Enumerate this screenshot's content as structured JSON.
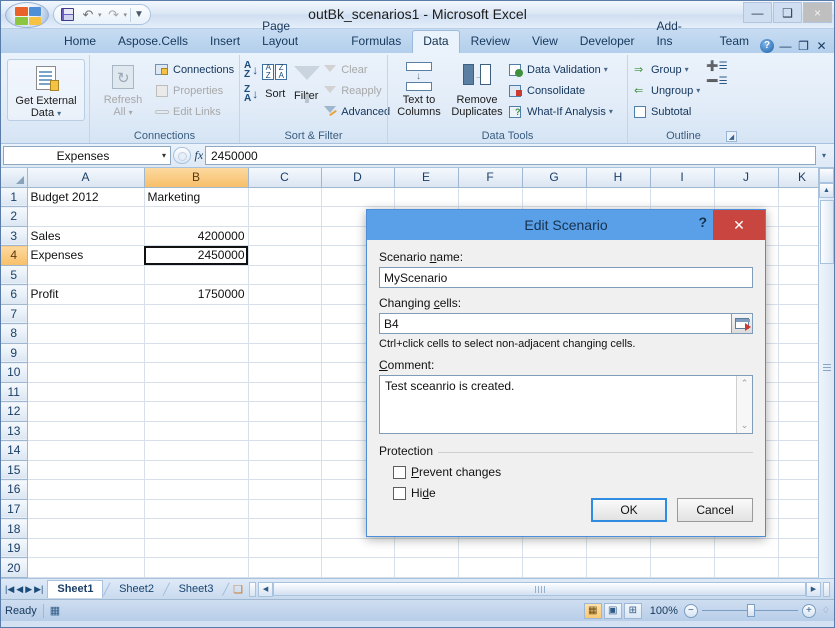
{
  "window": {
    "title": "outBk_scenarios1 - Microsoft Excel",
    "minimize": "—",
    "maximize": "❐",
    "close": "×"
  },
  "quick_access": {
    "office_button": "office-orb",
    "save": "save-icon",
    "undo": "↰",
    "undo_caret": "▾",
    "redo": "↱",
    "redo_caret": "▾",
    "customize": "▾"
  },
  "ribbon": {
    "tabs": [
      {
        "label": "Home",
        "active": false
      },
      {
        "label": "Aspose.Cells",
        "active": false
      },
      {
        "label": "Insert",
        "active": false
      },
      {
        "label": "Page Layout",
        "active": false
      },
      {
        "label": "Formulas",
        "active": false
      },
      {
        "label": "Data",
        "active": true
      },
      {
        "label": "Review",
        "active": false
      },
      {
        "label": "View",
        "active": false
      },
      {
        "label": "Developer",
        "active": false
      },
      {
        "label": "Add-Ins",
        "active": false
      },
      {
        "label": "Team",
        "active": false
      }
    ],
    "help_label": "?",
    "win_minimize": "—",
    "win_restore": "❐",
    "win_close": "✕",
    "groups": {
      "external": {
        "label": "",
        "button_line1": "Get External",
        "button_line2": "Data",
        "caret": "▾"
      },
      "connections": {
        "label": "Connections",
        "refresh_line1": "Refresh",
        "refresh_line2": "All",
        "refresh_caret": "▾",
        "items": [
          {
            "label": "Connections",
            "disabled": false
          },
          {
            "label": "Properties",
            "disabled": true
          },
          {
            "label": "Edit Links",
            "disabled": true
          }
        ]
      },
      "sort_filter": {
        "label": "Sort & Filter",
        "sort_az": "A\nZ",
        "sort_za": "Z\nA",
        "sort_label": "Sort",
        "filter_label": "Filter",
        "items": [
          {
            "label": "Clear",
            "disabled": true
          },
          {
            "label": "Reapply",
            "disabled": true
          },
          {
            "label": "Advanced",
            "disabled": false
          }
        ]
      },
      "data_tools": {
        "label": "Data Tools",
        "text_to_columns_line1": "Text to",
        "text_to_columns_line2": "Columns",
        "remove_duplicates_line1": "Remove",
        "remove_duplicates_line2": "Duplicates",
        "items": [
          {
            "label": "Data Validation",
            "caret": "▾"
          },
          {
            "label": "Consolidate",
            "caret": ""
          },
          {
            "label": "What-If Analysis",
            "caret": "▾"
          }
        ]
      },
      "outline": {
        "label": "Outline",
        "items": [
          {
            "label": "Group",
            "caret": "▾"
          },
          {
            "label": "Ungroup",
            "caret": "▾"
          },
          {
            "label": "Subtotal",
            "caret": ""
          }
        ],
        "launcher": "◢"
      }
    }
  },
  "formula_bar": {
    "name_box_value": "Expenses",
    "name_box_caret": "▾",
    "fx_label": "fx",
    "formula_value": "2450000",
    "expand_caret": "▾"
  },
  "grid": {
    "columns": [
      "A",
      "B",
      "C",
      "D",
      "E",
      "F",
      "G",
      "H",
      "I",
      "J",
      "K"
    ],
    "selected_column": "B",
    "rows": [
      1,
      2,
      3,
      4,
      5,
      6,
      7,
      8,
      9,
      10,
      11,
      12,
      13,
      14,
      15,
      16,
      17,
      18,
      19,
      20
    ],
    "selected_row": 4,
    "active_cell": "B4",
    "cells": {
      "A1": "Budget 2012",
      "B1": "Marketing",
      "A3": "Sales",
      "B3": "4200000",
      "A4": "Expenses",
      "B4": "2450000",
      "A6": "Profit",
      "B6": "1750000"
    }
  },
  "sheet_tabs": {
    "nav_first": "|◀",
    "nav_prev": "◀",
    "nav_next": "▶",
    "nav_last": "▶|",
    "tabs": [
      {
        "label": "Sheet1",
        "active": true
      },
      {
        "label": "Sheet2",
        "active": false
      },
      {
        "label": "Sheet3",
        "active": false
      }
    ],
    "insert_sheet": "new-sheet-icon"
  },
  "status_bar": {
    "state": "Ready",
    "view_normal": "▦",
    "view_layout": "▣",
    "view_break": "⊞",
    "zoom_level": "100%",
    "zoom_out": "−",
    "zoom_in": "+"
  },
  "dialog": {
    "title": "Edit Scenario",
    "help": "?",
    "close": "✕",
    "scenario_name_label": "Scenario name:",
    "scenario_name_value": "MyScenario",
    "changing_cells_label": "Changing cells:",
    "changing_cells_value": "B4",
    "picker_icon": "range-picker-icon",
    "hint": "Ctrl+click cells to select non-adjacent changing cells.",
    "comment_label": "Comment:",
    "comment_value": "Test sceanrio is created.",
    "scroll_up": "⌃",
    "scroll_down": "⌄",
    "protection_label": "Protection",
    "prevent_changes_label": "Prevent changes",
    "prevent_changes_checked": false,
    "hide_label": "Hide",
    "hide_checked": false,
    "ok_label": "OK",
    "cancel_label": "Cancel"
  },
  "colors": {
    "title_blue": "#5aa0e8",
    "close_red": "#c9453f",
    "selected_header": "#f7bf69",
    "ribbon_text": "#13355c"
  }
}
